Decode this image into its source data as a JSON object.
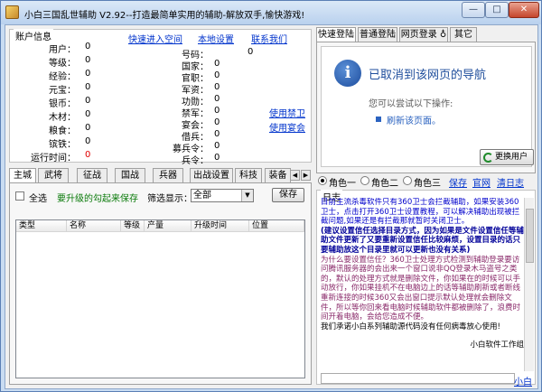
{
  "window": {
    "title": "小白三国乱世辅助 V2.92--打造最简单实用的辅助-解放双手,愉快游戏!",
    "min_label": "—",
    "max_label": "□",
    "close_label": "✕"
  },
  "account": {
    "legend": "账户信息",
    "links": [
      "快速进入空间",
      "本地设置",
      "联系我们"
    ],
    "left_fields": [
      {
        "label": "用户：",
        "value": "0"
      },
      {
        "label": "等级：",
        "value": "0"
      },
      {
        "label": "经验：",
        "value": "0"
      },
      {
        "label": "元宝：",
        "value": "0"
      },
      {
        "label": "银币：",
        "value": "0"
      },
      {
        "label": "木材：",
        "value": "0"
      },
      {
        "label": "粮食：",
        "value": "0"
      },
      {
        "label": "镔铁：",
        "value": "0"
      },
      {
        "label": "运行时间：",
        "value": "0"
      }
    ],
    "mid_fields": [
      {
        "label": "号码：",
        "value": "0"
      },
      {
        "label": "国家：",
        "value": "0"
      },
      {
        "label": "官职：",
        "value": "0"
      },
      {
        "label": "军资：",
        "value": "0"
      },
      {
        "label": "功勋：",
        "value": "0"
      },
      {
        "label": "禁军：",
        "value": "0"
      },
      {
        "label": "宴会：",
        "value": "0"
      },
      {
        "label": "借兵：",
        "value": "0"
      },
      {
        "label": "募兵令：",
        "value": "0"
      },
      {
        "label": "兵令：",
        "value": "0"
      }
    ],
    "side_links": [
      "使用禁卫",
      "使用宴会"
    ]
  },
  "tabs": [
    "主城",
    "武将",
    "征战",
    "国战",
    "兵器",
    "出战设置",
    "科技",
    "装备"
  ],
  "main_panel": {
    "select_all": "全选",
    "hint": "要升级的勾起来保存",
    "filter_label": "筛选显示：",
    "filter_value": "全部",
    "save_label": "保存",
    "columns": [
      "类型",
      "名称",
      "等级",
      "产量",
      "升级时间",
      "位置"
    ]
  },
  "right_tabs": [
    "快速登陆",
    "普通登陆",
    "网页登录 ♁",
    "其它"
  ],
  "browser": {
    "title": "已取消到该网页的导航",
    "subtitle": "您可以尝试以下操作:",
    "refresh_link": "刷新该页面。",
    "switch_user": "更换用户"
  },
  "roles": {
    "options": [
      "角色一",
      "角色二",
      "角色三"
    ],
    "selected": 0,
    "links": [
      "保存",
      "官网",
      "清日志"
    ]
  },
  "log": {
    "legend": "日志",
    "lines": [
      {
        "style": "blue",
        "text": "目前主流杀毒软件只有360卫士会拦截辅助，如果安装360卫士，点击打开360卫士设置教程，可以解决辅助出现被拦截问题,如果还是有拦截那就暂时关闭卫士。"
      },
      {
        "style": "navy",
        "text": "(建议设置信任选择目录方式，因为如果是文件设置信任等辅助文件更新了又要重新设置信任比较麻烦，设置目录的话只要辅助放这个目录里就可以更新也没有关系)"
      },
      {
        "style": "plum",
        "text": "为什么要设置信任？360卫士处理方式检测到辅助登录要访问腾讯服务器的会出来一个窗口说非QQ登录木马盗号之类的，默认的处理方式就是删除文件，你如果在的时候可以手动放行，你如果挂机不在电脑边上的话等辅助刷新或者断线重新连接的时候360又会出窗口提示默认处理就会删除文件，所以等你回来看电脑时候辅助软件都被删除了，浪费时间开着电脑，会给您造成不便。"
      },
      {
        "style": "black",
        "text": "我们承诺小白系列辅助源代码没有任何病毒放心使用!"
      }
    ],
    "signature": "小白软件工作组",
    "footer_link": "小白"
  }
}
